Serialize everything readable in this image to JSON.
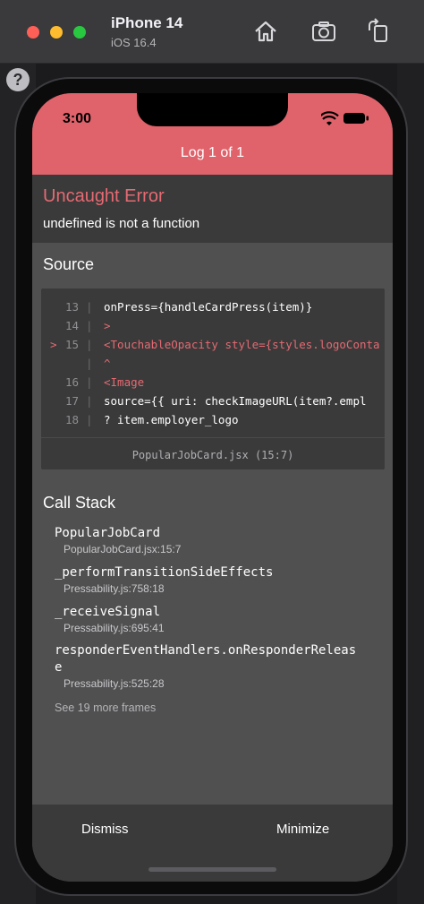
{
  "simulator": {
    "device_name": "iPhone 14",
    "os_version": "iOS 16.4",
    "icons": [
      "home-icon",
      "screenshot-icon",
      "rotate-icon"
    ]
  },
  "help_label": "?",
  "status_bar": {
    "time": "3:00",
    "icons": [
      "wifi-icon",
      "battery-icon"
    ]
  },
  "header": {
    "title": "Log 1 of 1"
  },
  "error": {
    "title": "Uncaught Error",
    "message": "undefined is not a function"
  },
  "source": {
    "title": "Source",
    "lines": [
      {
        "marker": "",
        "num": "13",
        "sep": "|",
        "code": "onPress={handleCardPress(item)}",
        "highlight": false
      },
      {
        "marker": "",
        "num": "14",
        "sep": "|",
        "code": ">",
        "highlight": true
      },
      {
        "marker": ">",
        "num": "15",
        "sep": "|",
        "code": "<TouchableOpacity style={styles.logoConta",
        "highlight": true
      },
      {
        "marker": "",
        "num": "",
        "sep": "|",
        "code": "^",
        "highlight": true
      },
      {
        "marker": "",
        "num": "16",
        "sep": "|",
        "code": "  <Image",
        "highlight": true
      },
      {
        "marker": "",
        "num": "17",
        "sep": "|",
        "code": "  source={{ uri: checkImageURL(item?.empl",
        "highlight": false
      },
      {
        "marker": "",
        "num": "18",
        "sep": "|",
        "code": "        ? item.employer_logo",
        "highlight": false
      }
    ],
    "file": "PopularJobCard.jsx (15:7)"
  },
  "call_stack": {
    "title": "Call Stack",
    "frames": [
      {
        "name": "PopularJobCard",
        "location": "PopularJobCard.jsx:15:7"
      },
      {
        "name": "_performTransitionSideEffects",
        "location": "Pressability.js:758:18"
      },
      {
        "name": "_receiveSignal",
        "location": "Pressability.js:695:41"
      },
      {
        "name": "responderEventHandlers.onResponderReleas",
        "name_cont": "e",
        "location": "Pressability.js:525:28"
      }
    ],
    "see_more": "See 19 more frames"
  },
  "actions": {
    "dismiss": "Dismiss",
    "minimize": "Minimize"
  },
  "colors": {
    "header": "#e0626b",
    "error_text": "#e56a73",
    "screen_bg": "#505050",
    "panel_bg": "#3a3a3a"
  }
}
